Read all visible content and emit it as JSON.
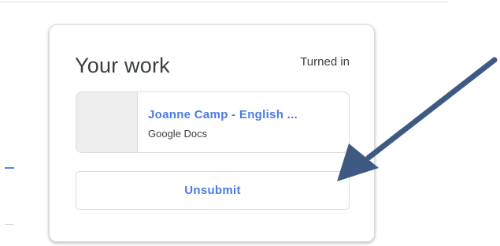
{
  "card": {
    "title": "Your work",
    "status": "Turned in",
    "attachment": {
      "title": "Joanne Camp - English ...",
      "subtitle": "Google Docs"
    },
    "unsubmit_label": "Unsubmit"
  },
  "colors": {
    "accent": "#4a7be0",
    "annotation_arrow": "#3f5a82",
    "text": "#3c4043",
    "border": "#dadce0",
    "thumbnail": "#eeeeee"
  },
  "icons": {
    "annotation": "arrow-pointer-icon"
  }
}
